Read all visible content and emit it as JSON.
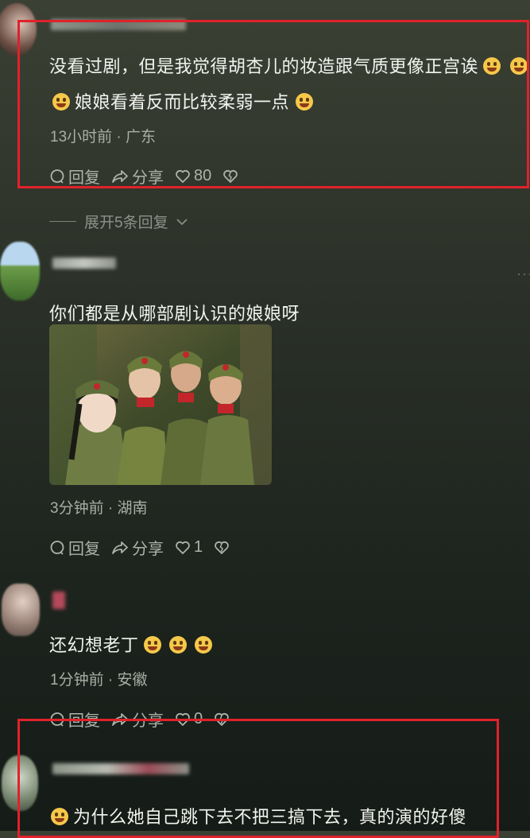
{
  "comments": [
    {
      "text_line1": "没看过剧，但是我觉得胡杏儿的妆造跟气质更像正宫诶",
      "text_line2": "娘娘看着反而比较柔弱一点",
      "meta": "13小时前 · 广东",
      "reply_label": "回复",
      "share_label": "分享",
      "likes": "80",
      "expand_label": "展开5条回复"
    },
    {
      "text": "你们都是从哪部剧认识的娘娘呀",
      "meta": "3分钟前 · 湖南",
      "reply_label": "回复",
      "share_label": "分享",
      "likes": "1"
    },
    {
      "text": "还幻想老丁",
      "meta": "1分钟前 · 安徽",
      "reply_label": "回复",
      "share_label": "分享",
      "likes": "0"
    },
    {
      "text": "为什么她自己跳下去不把三搞下去，真的演的好傻"
    }
  ],
  "colors": {
    "highlight": "#e0222b",
    "background": "#2b3128",
    "meta": "#a9aea5"
  },
  "icons": [
    "comment-bubble-icon",
    "share-arrow-icon",
    "heart-icon",
    "broken-heart-icon",
    "laughing-emoji-icon",
    "rofl-emoji-icon",
    "chevron-down-icon"
  ]
}
